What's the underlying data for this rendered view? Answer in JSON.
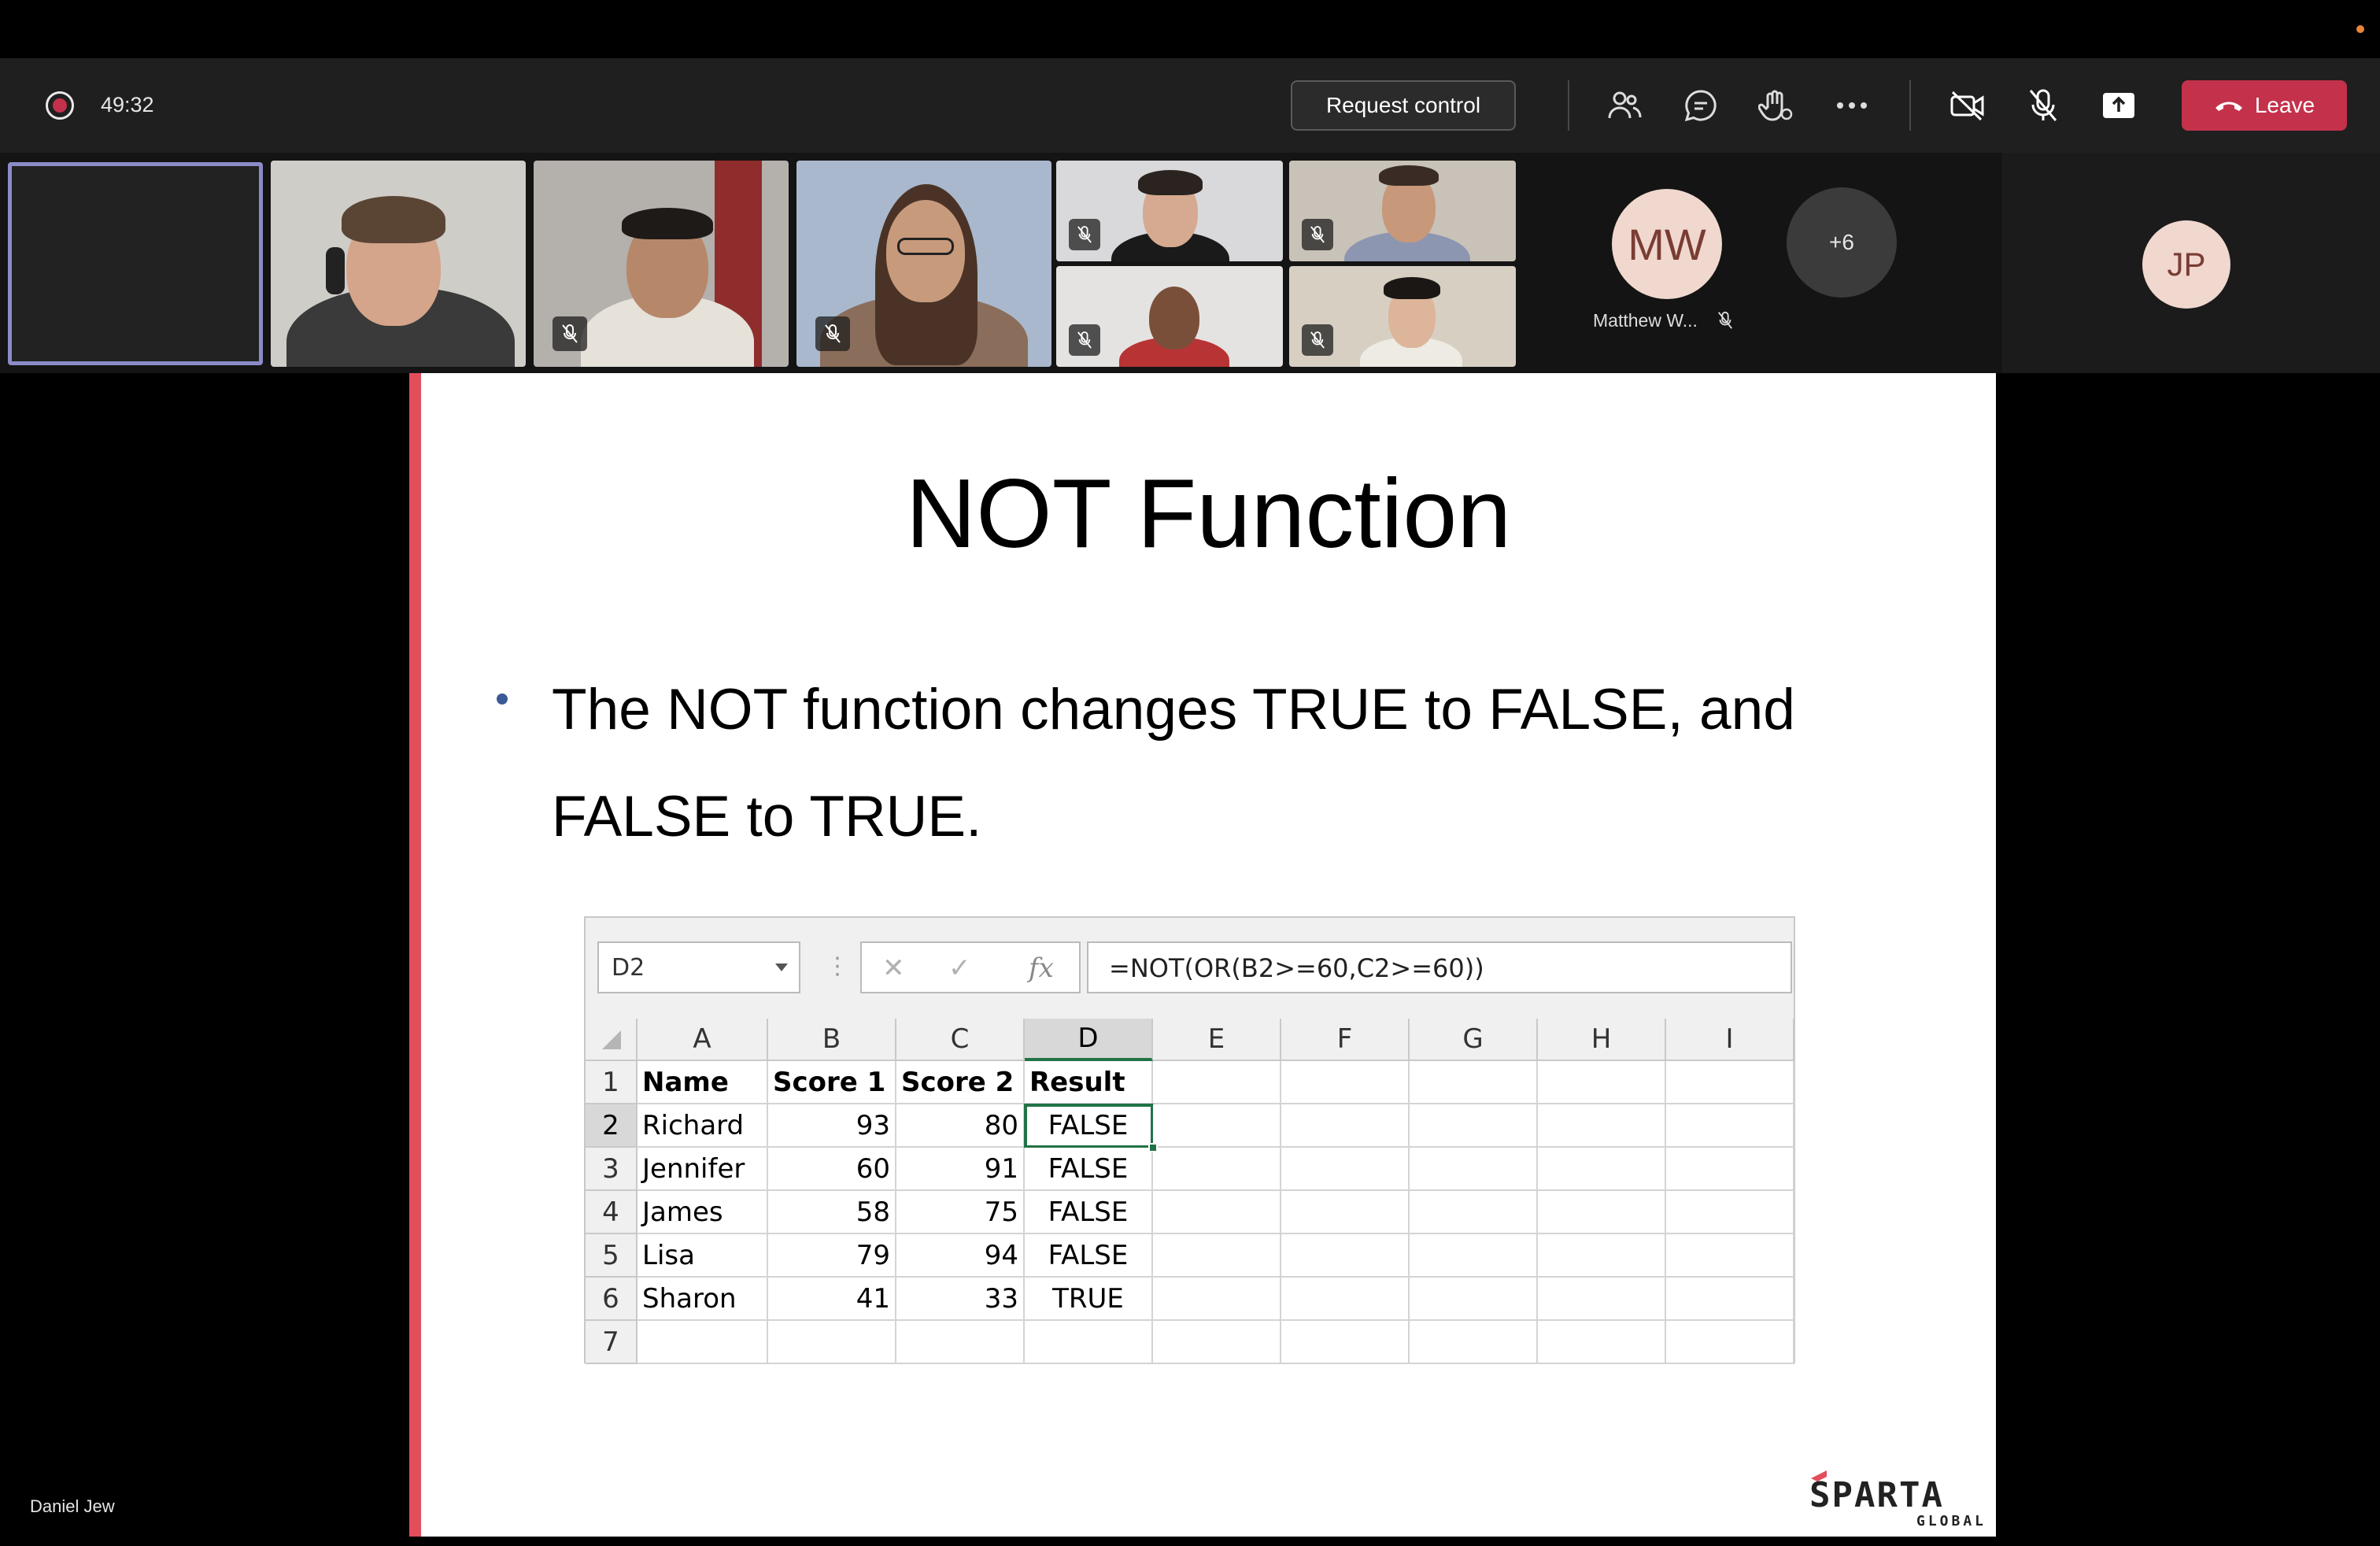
{
  "meeting": {
    "timer": "49:32",
    "request_control_label": "Request control",
    "leave_label": "Leave",
    "icons": [
      "people-icon",
      "chat-icon",
      "raise-hand-icon",
      "more-icon",
      "camera-off-icon",
      "mic-off-icon",
      "share-icon"
    ]
  },
  "participants": {
    "mw_initials": "MW",
    "mw_name": "Matthew W...",
    "overflow_count": "+6",
    "jp_initials": "JP",
    "speaker_name": "Daniel Jew"
  },
  "slide": {
    "title": "NOT Function",
    "bullet": "The NOT function changes TRUE to FALSE, and FALSE to TRUE.",
    "logo_main": "SPARTA",
    "logo_sub": "GLOBAL",
    "accent_color": "#e24e5b"
  },
  "excel": {
    "name_box": "D2",
    "formula": "=NOT(OR(B2>=60,C2>=60))",
    "columns": [
      "A",
      "B",
      "C",
      "D",
      "E",
      "F",
      "G",
      "H",
      "I"
    ],
    "row_numbers": [
      "1",
      "2",
      "3",
      "4",
      "5",
      "6",
      "7"
    ],
    "header": [
      "Name",
      "Score 1",
      "Score 2",
      "Result"
    ],
    "rows": [
      [
        "Richard",
        "93",
        "80",
        "FALSE"
      ],
      [
        "Jennifer",
        "60",
        "91",
        "FALSE"
      ],
      [
        "James",
        "58",
        "75",
        "FALSE"
      ],
      [
        "Lisa",
        "79",
        "94",
        "FALSE"
      ],
      [
        "Sharon",
        "41",
        "33",
        "TRUE"
      ],
      [
        "",
        "",
        "",
        ""
      ]
    ]
  }
}
